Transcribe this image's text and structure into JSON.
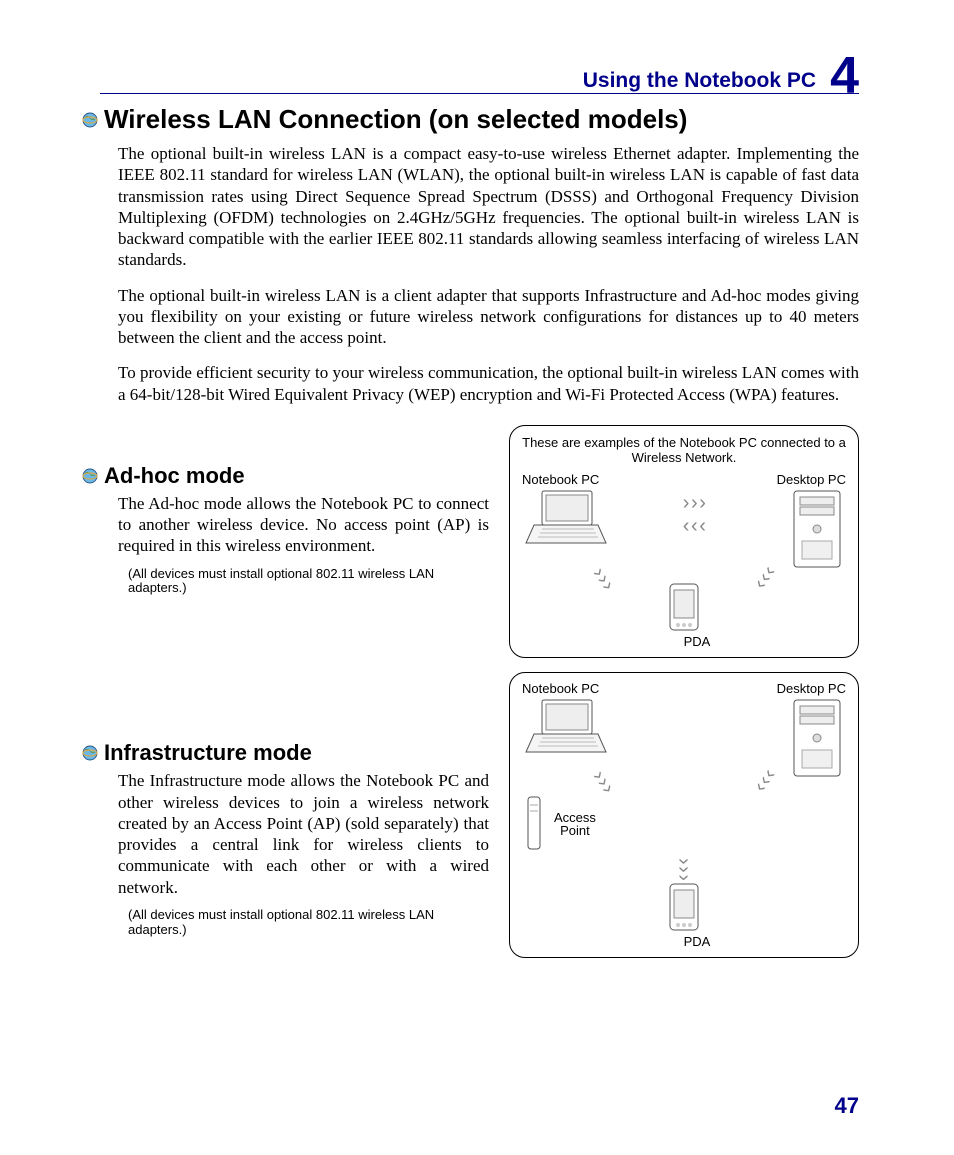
{
  "header": {
    "section": "Using the Notebook PC",
    "chapter": "4"
  },
  "h1": "Wireless LAN Connection (on selected models)",
  "p1": "The optional built-in wireless LAN is a compact easy-to-use wireless Ethernet adapter. Implementing the IEEE 802.11 standard for wireless LAN (WLAN), the optional built-in wireless LAN is capable of fast data transmission rates using Direct Sequence Spread Spectrum (DSSS) and Orthogonal Frequency Division Multiplexing (OFDM) technologies on 2.4GHz/5GHz frequencies. The optional built-in wireless LAN is backward compatible with the earlier IEEE 802.11 standards allowing seamless interfacing of wireless LAN standards.",
  "p2": "The optional built-in wireless LAN is a client adapter that supports Infrastructure and Ad-hoc modes giving you flexibility on your existing or future wireless network configurations for distances up to 40 meters between the client and the access point.",
  "p3": "To provide efficient security to your wireless communication, the optional built-in wireless LAN comes with a 64-bit/128-bit Wired Equivalent Privacy (WEP) encryption and Wi-Fi Protected Access (WPA) features.",
  "adhoc": {
    "title": "Ad-hoc mode",
    "body": "The Ad-hoc mode allows the Notebook PC to connect to another wireless device. No access point (AP) is required in this wireless environment.",
    "note": "(All devices must install optional 802.11 wireless LAN adapters.)"
  },
  "infra": {
    "title": "Infrastructure mode",
    "body": "The Infrastructure mode allows the Notebook PC and other wireless devices to join a wireless network created by an Access Point (AP) (sold separately) that provides a central link for wireless clients to communicate with each other or with a wired network.",
    "note": "(All devices must install optional 802.11 wireless LAN adapters.)"
  },
  "diagram": {
    "caption": "These are examples of the Notebook PC connected to a Wireless Network.",
    "labels": {
      "notebook": "Notebook PC",
      "desktop": "Desktop PC",
      "pda": "PDA",
      "ap1": "Access",
      "ap2": "Point"
    }
  },
  "page": "47"
}
